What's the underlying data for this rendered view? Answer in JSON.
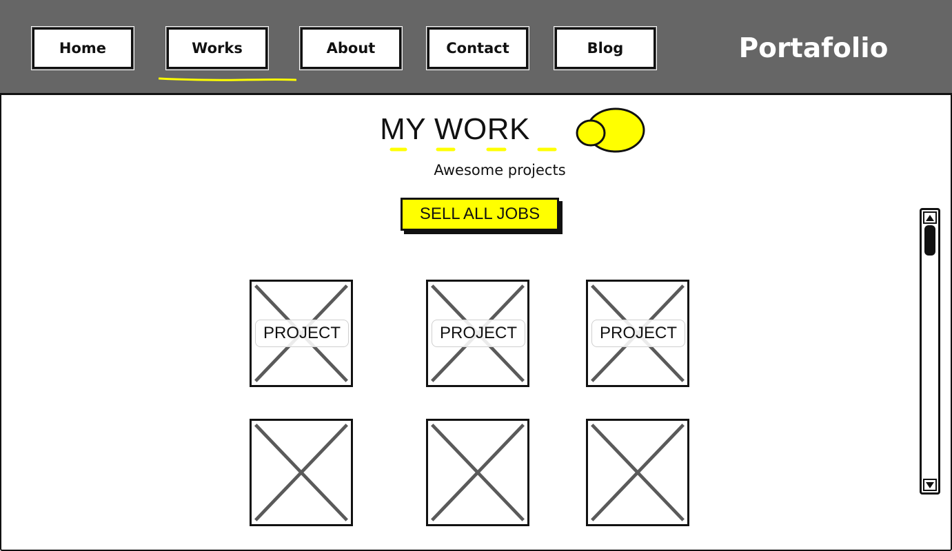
{
  "nav": {
    "items": [
      {
        "label": "Home",
        "active": false
      },
      {
        "label": "Works",
        "active": true
      },
      {
        "label": "About",
        "active": false
      },
      {
        "label": "Contact",
        "active": false
      },
      {
        "label": "Blog",
        "active": false
      }
    ],
    "brand": "Portafolio"
  },
  "main": {
    "title": "MY WORK",
    "subtitle": "Awesome projects",
    "cta_label": "SELL ALL JOBS",
    "project_label": "PROJECT",
    "project_rows": [
      {
        "tiles": [
          {
            "label": "PROJECT"
          },
          {
            "label": "PROJECT"
          },
          {
            "label": "PROJECT"
          }
        ]
      },
      {
        "tiles": [
          {
            "label": ""
          },
          {
            "label": ""
          },
          {
            "label": ""
          }
        ]
      }
    ]
  },
  "scrollbar": {
    "up_icon": "arrow-up-icon",
    "down_icon": "arrow-down-icon",
    "position": 0
  },
  "colors": {
    "header_bg": "#666666",
    "accent": "#ffff00",
    "ink": "#111111",
    "placeholder_x": "#5a5a5a"
  }
}
